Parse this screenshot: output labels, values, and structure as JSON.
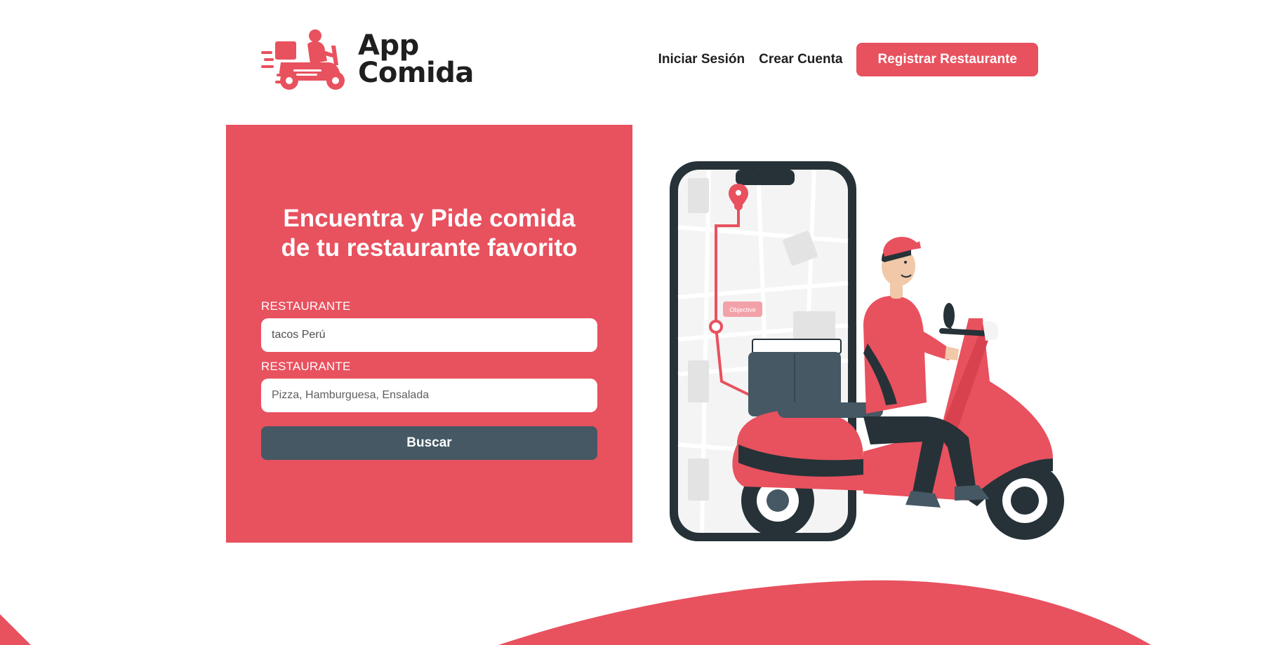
{
  "brand": {
    "name_line1": "App",
    "name_line2": "Comida",
    "accent_color": "#e8515e",
    "dark_color": "#455864"
  },
  "nav": {
    "login_label": "Iniciar Sesión",
    "signup_label": "Crear Cuenta",
    "register_restaurant_label": "Registrar Restaurante"
  },
  "search": {
    "title": "Encuentra y Pide comida de tu restaurante favorito",
    "restaurant_label": "RESTAURANTE",
    "restaurant_value": "tacos Perú",
    "food_label": "RESTAURANTE",
    "food_placeholder": "Pizza, Hamburguesa, Ensalada",
    "submit_label": "Buscar"
  },
  "illustration": {
    "map_tag": "Objective"
  }
}
